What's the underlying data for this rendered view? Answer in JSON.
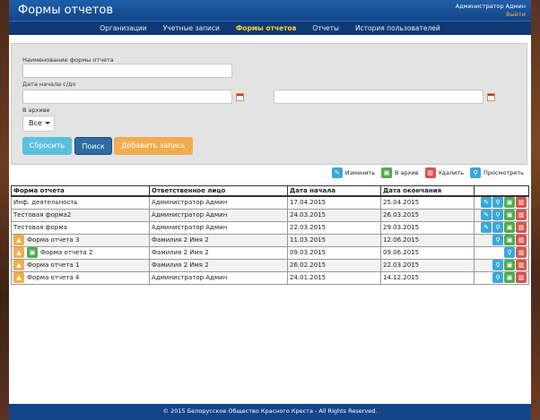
{
  "header": {
    "title": "Формы отчетов",
    "user_name": "Администратор Админ",
    "logout": "Выйти"
  },
  "nav": {
    "items": [
      {
        "label": "Организации",
        "active": false
      },
      {
        "label": "Учетные записи",
        "active": false
      },
      {
        "label": "Формы отчетов",
        "active": true
      },
      {
        "label": "Отчеты",
        "active": false
      },
      {
        "label": "История пользователей",
        "active": false
      }
    ]
  },
  "filter": {
    "name_label": "Наименование формы отчета",
    "name_value": "",
    "date_label": "Дата начала с/до",
    "date_from": "",
    "date_to": "",
    "archive_label": "В архиве",
    "archive_value": "Все",
    "reset_label": "Сбросить",
    "search_label": "Поиск",
    "add_label": "Добавить запись"
  },
  "legend": {
    "edit": "Изменить",
    "archive": "В архив",
    "delete": "Удалить",
    "view": "Просмотреть"
  },
  "table": {
    "headers": [
      "Форма отчета",
      "Ответственное лицо",
      "Дата начала",
      "Дата окончания"
    ],
    "rows": [
      {
        "name": "Инф. деятельность",
        "person": "Администратор Админ",
        "start": "17.04.2015",
        "end": "25.04.2015",
        "lock": false,
        "lock_arch": false,
        "actions": [
          "edit",
          "view",
          "arch",
          "del"
        ]
      },
      {
        "name": "Тестовая форма2",
        "person": "Администратор Админ",
        "start": "24.03.2015",
        "end": "26.03.2015",
        "lock": false,
        "lock_arch": false,
        "actions": [
          "edit",
          "view",
          "arch",
          "del"
        ]
      },
      {
        "name": "Тестовая форма",
        "person": "Администратор Админ",
        "start": "22.03.2015",
        "end": "29.03.2015",
        "lock": false,
        "lock_arch": false,
        "actions": [
          "edit",
          "view",
          "arch",
          "del"
        ]
      },
      {
        "name": "Форма отчета 3",
        "person": "Фамилия 2 Имя 2",
        "start": "11.03.2015",
        "end": "12.06.2015",
        "lock": true,
        "lock_arch": false,
        "actions": [
          "view",
          "arch",
          "del"
        ]
      },
      {
        "name": "Форма отчета 2",
        "person": "Фамилия 2 Имя 2",
        "start": "09.03.2015",
        "end": "09.06.2015",
        "lock": true,
        "lock_arch": true,
        "actions": [
          "view",
          "del"
        ]
      },
      {
        "name": "Форма отчета 1",
        "person": "Фамилия 2 Имя 2",
        "start": "26.02.2015",
        "end": "22.03.2015",
        "lock": true,
        "lock_arch": false,
        "actions": [
          "view",
          "arch",
          "del"
        ]
      },
      {
        "name": "Форма отчета 4",
        "person": "Администратор Админ",
        "start": "24.01.2015",
        "end": "14.12.2015",
        "lock": true,
        "lock_arch": false,
        "actions": [
          "view",
          "arch",
          "del"
        ]
      }
    ]
  },
  "footer": {
    "text": "© 2015 Белорусское Общество Красного Креста  -   All Rights Reserved."
  }
}
